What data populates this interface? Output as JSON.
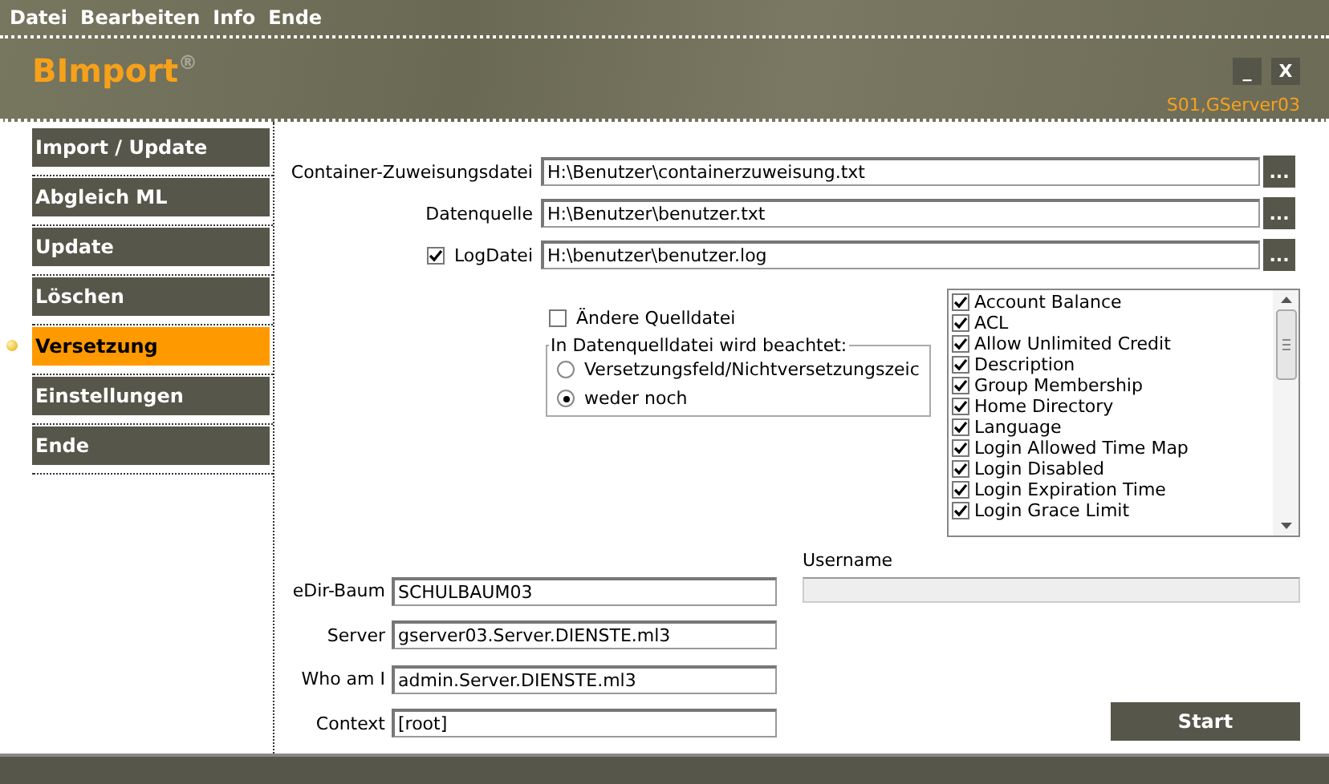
{
  "menu": [
    "Datei",
    "Bearbeiten",
    "Info",
    "Ende"
  ],
  "header": {
    "title": "BImport",
    "mark": "®",
    "minimize": "_",
    "close": "X",
    "server": "S01,GServer03"
  },
  "sidebar": [
    {
      "label": "Import / Update",
      "selected": false
    },
    {
      "label": "Abgleich ML",
      "selected": false
    },
    {
      "label": "Update",
      "selected": false
    },
    {
      "label": "Löschen",
      "selected": false
    },
    {
      "label": "Versetzung",
      "selected": true
    },
    {
      "label": "Einstellungen",
      "selected": false
    },
    {
      "label": "Ende",
      "selected": false
    }
  ],
  "files": [
    {
      "kind": "label",
      "label": "Container-Zuweisungsdatei",
      "value": "H:\\Benutzer\\containerzuweisung.txt",
      "browse": "..."
    },
    {
      "kind": "label",
      "label": "Datenquelle",
      "value": "H:\\Benutzer\\benutzer.txt",
      "browse": "..."
    },
    {
      "kind": "checkbox",
      "label": "LogDatei",
      "checked": true,
      "value": "H:\\benutzer\\benutzer.log",
      "browse": "..."
    }
  ],
  "change_source": {
    "label": "Ändere Quelldatei",
    "checked": false
  },
  "group": {
    "title": "In Datenquelldatei wird beachtet:",
    "options": [
      {
        "label": "Versetzungsfeld/Nichtversetzungszeic",
        "selected": false
      },
      {
        "label": "weder noch",
        "selected": true
      }
    ]
  },
  "attributes": [
    {
      "label": "Account Balance",
      "checked": true
    },
    {
      "label": "ACL",
      "checked": true
    },
    {
      "label": "Allow Unlimited Credit",
      "checked": true
    },
    {
      "label": "Description",
      "checked": true
    },
    {
      "label": "Group Membership",
      "checked": true
    },
    {
      "label": "Home Directory",
      "checked": true
    },
    {
      "label": "Language",
      "checked": true
    },
    {
      "label": "Login Allowed Time Map",
      "checked": true
    },
    {
      "label": "Login Disabled",
      "checked": true
    },
    {
      "label": "Login Expiration Time",
      "checked": true
    },
    {
      "label": "Login Grace Limit",
      "checked": true
    }
  ],
  "connection": [
    {
      "label": "eDir-Baum",
      "value": "SCHULBAUM03"
    },
    {
      "label": "Server",
      "value": "gserver03.Server.DIENSTE.ml3"
    },
    {
      "label": "Who am I",
      "value": "admin.Server.DIENSTE.ml3"
    },
    {
      "label": "Context",
      "value": "[root]"
    }
  ],
  "username": {
    "label": "Username"
  },
  "start_button": "Start"
}
